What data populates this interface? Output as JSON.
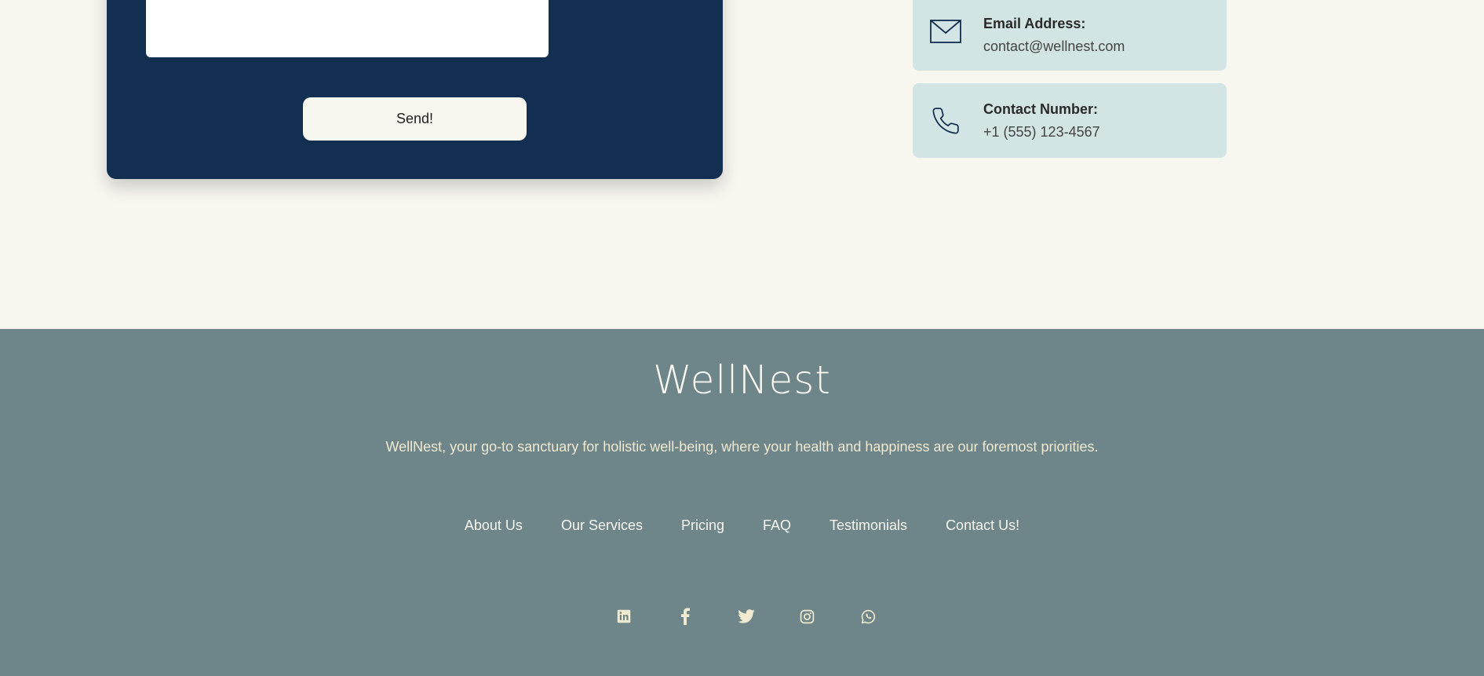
{
  "form": {
    "message_value": "",
    "send_label": "Send!"
  },
  "contact_info": {
    "email": {
      "label": "Email Address:",
      "value": "contact@wellnest.com",
      "icon": "envelope-icon"
    },
    "phone": {
      "label": "Contact Number:",
      "value": "+1 (555) 123-4567",
      "icon": "phone-icon"
    }
  },
  "footer": {
    "brand": "WellNest",
    "tagline": "WellNest, your go-to sanctuary for holistic well-being, where your health and happiness are our foremost priorities.",
    "nav": [
      {
        "label": "About Us"
      },
      {
        "label": "Our Services"
      },
      {
        "label": "Pricing"
      },
      {
        "label": "FAQ"
      },
      {
        "label": "Testimonials"
      },
      {
        "label": "Contact Us!"
      }
    ],
    "social": [
      {
        "icon": "linkedin-icon"
      },
      {
        "icon": "facebook-icon"
      },
      {
        "icon": "twitter-icon"
      },
      {
        "icon": "instagram-icon"
      },
      {
        "icon": "whatsapp-icon"
      }
    ]
  },
  "colors": {
    "page_background": "#f7f6ef",
    "form_card": "#122e50",
    "info_card": "#d3e4e4",
    "footer_background": "#6e8589",
    "footer_text": "#f7f6ef",
    "tagline_text": "#f0ead0"
  }
}
